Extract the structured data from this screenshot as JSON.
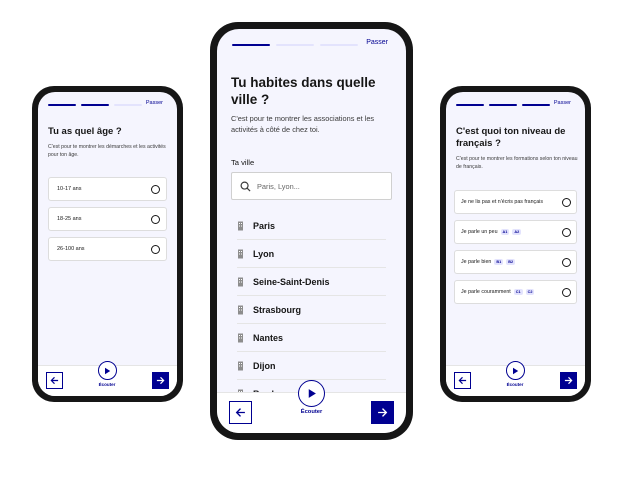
{
  "colors": {
    "primary": "#000091",
    "screen_bg": "#f5f5fe",
    "phone_frame": "#161616"
  },
  "phone_left": {
    "progress": {
      "step": 2,
      "total": 3
    },
    "skip_label": "Passer",
    "title": "Tu as quel âge ?",
    "subtitle": "C'est pour te montrer les démarches et les activités pour ton âge.",
    "options": [
      {
        "label": "10-17 ans"
      },
      {
        "label": "18-25 ans"
      },
      {
        "label": "26-100 ans"
      }
    ],
    "listen_label": "Écouter",
    "icons": {
      "back": "arrow-left-icon",
      "next": "arrow-right-icon",
      "listen": "play-icon"
    }
  },
  "phone_center": {
    "progress": {
      "step": 1,
      "total": 3
    },
    "skip_label": "Passer",
    "title": "Tu habites dans quelle ville ?",
    "subtitle": "C'est pour te montrer les associations et les activités à côté de chez toi.",
    "city_label": "Ta ville",
    "search_placeholder": "Paris, Lyon...",
    "cities": [
      "Paris",
      "Lyon",
      "Seine-Saint-Denis",
      "Strasbourg",
      "Nantes",
      "Dijon",
      "Bordeaux"
    ],
    "listen_label": "Écouter",
    "icons": {
      "search": "search-icon",
      "city": "building-icon",
      "back": "arrow-left-icon",
      "next": "arrow-right-icon",
      "listen": "play-icon"
    }
  },
  "phone_right": {
    "progress": {
      "step": 3,
      "total": 3
    },
    "skip_label": "Passer",
    "title": "C'est quoi ton niveau de français ?",
    "subtitle": "C'est pour te montrer les formations selon ton niveau de français.",
    "options": [
      {
        "label": "Je ne lis pas et n'écris pas français",
        "badges": []
      },
      {
        "label": "Je parle un peu",
        "badges": [
          "A1",
          "A2"
        ]
      },
      {
        "label": "Je parle bien",
        "badges": [
          "B1",
          "B2"
        ]
      },
      {
        "label": "Je parle couramment",
        "badges": [
          "C1",
          "C2"
        ]
      }
    ],
    "listen_label": "Écouter",
    "icons": {
      "back": "arrow-left-icon",
      "next": "arrow-right-icon",
      "listen": "play-icon"
    }
  }
}
